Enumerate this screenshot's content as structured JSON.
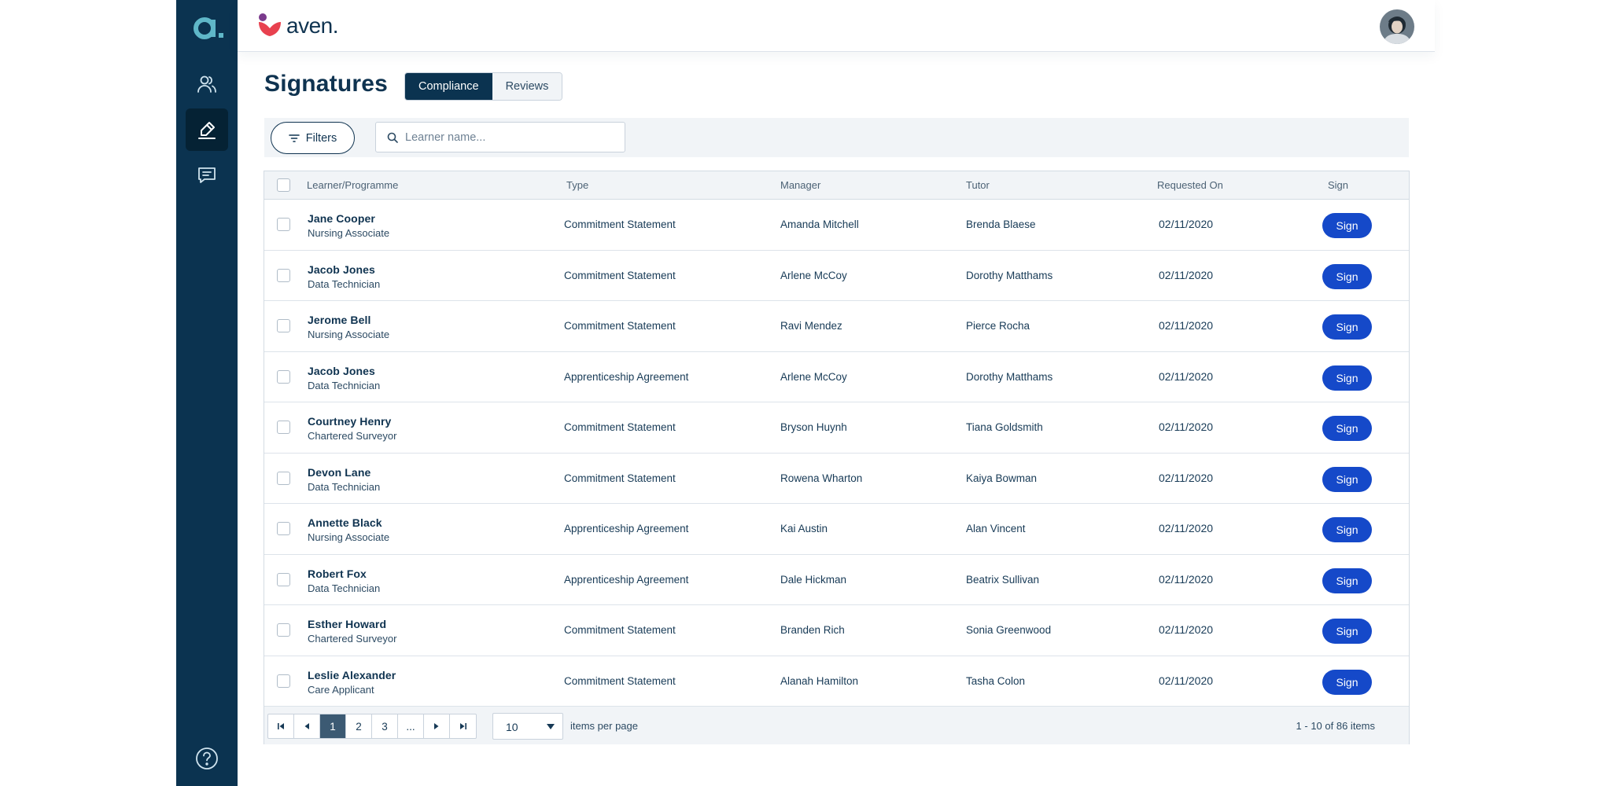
{
  "brand": {
    "name": "aven.",
    "sidebar_logo": "a."
  },
  "sidebar": {
    "items": [
      {
        "icon": "users-icon",
        "active": false
      },
      {
        "icon": "signature-pen-icon",
        "active": true
      },
      {
        "icon": "chat-icon",
        "active": false
      }
    ],
    "help_icon": "help-circle-icon"
  },
  "page": {
    "title": "Signatures",
    "tabs": [
      {
        "label": "Compliance",
        "active": true
      },
      {
        "label": "Reviews",
        "active": false
      }
    ]
  },
  "toolbar": {
    "filters_label": "Filters",
    "search_placeholder": "Learner name..."
  },
  "table": {
    "columns": [
      "Learner/Programme",
      "Type",
      "Manager",
      "Tutor",
      "Requested On",
      "Sign"
    ],
    "rows": [
      {
        "name": "Jane Cooper",
        "programme": "Nursing Associate",
        "type": "Commitment Statement",
        "manager": "Amanda Mitchell",
        "tutor": "Brenda Blaese",
        "requested_on": "02/11/2020",
        "action": "Sign"
      },
      {
        "name": "Jacob Jones",
        "programme": "Data Technician",
        "type": "Commitment Statement",
        "manager": "Arlene McCoy",
        "tutor": "Dorothy Matthams",
        "requested_on": "02/11/2020",
        "action": "Sign"
      },
      {
        "name": "Jerome Bell",
        "programme": "Nursing Associate",
        "type": "Commitment Statement",
        "manager": "Ravi Mendez",
        "tutor": "Pierce Rocha",
        "requested_on": "02/11/2020",
        "action": "Sign"
      },
      {
        "name": "Jacob Jones",
        "programme": "Data Technician",
        "type": "Apprenticeship Agreement",
        "manager": "Arlene McCoy",
        "tutor": "Dorothy Matthams",
        "requested_on": "02/11/2020",
        "action": "Sign"
      },
      {
        "name": "Courtney Henry",
        "programme": "Chartered Surveyor",
        "type": "Commitment Statement",
        "manager": "Bryson Huynh",
        "tutor": "Tiana Goldsmith",
        "requested_on": "02/11/2020",
        "action": "Sign"
      },
      {
        "name": "Devon Lane",
        "programme": "Data Technician",
        "type": "Commitment Statement",
        "manager": "Rowena Wharton",
        "tutor": "Kaiya Bowman",
        "requested_on": "02/11/2020",
        "action": "Sign"
      },
      {
        "name": "Annette Black",
        "programme": "Nursing Associate",
        "type": "Apprenticeship Agreement",
        "manager": "Kai Austin",
        "tutor": "Alan Vincent",
        "requested_on": "02/11/2020",
        "action": "Sign"
      },
      {
        "name": "Robert Fox",
        "programme": "Data Technician",
        "type": "Apprenticeship Agreement",
        "manager": "Dale Hickman",
        "tutor": "Beatrix Sullivan",
        "requested_on": "02/11/2020",
        "action": "Sign"
      },
      {
        "name": "Esther Howard",
        "programme": "Chartered Surveyor",
        "type": "Commitment Statement",
        "manager": "Branden Rich",
        "tutor": "Sonia Greenwood",
        "requested_on": "02/11/2020",
        "action": "Sign"
      },
      {
        "name": "Leslie Alexander",
        "programme": "Care Applicant",
        "type": "Commitment Statement",
        "manager": "Alanah Hamilton",
        "tutor": "Tasha Colon",
        "requested_on": "02/11/2020",
        "action": "Sign"
      }
    ]
  },
  "pagination": {
    "pages": [
      "1",
      "2",
      "3",
      "..."
    ],
    "current_page": "1",
    "per_page": "10",
    "per_page_label": "items per page",
    "summary": "1 - 10 of 86 items"
  },
  "colors": {
    "sidebar": "#0b3350",
    "primary_text": "#0f3350",
    "sign_button": "#1549c9",
    "brand_accent": "#e8414f"
  }
}
